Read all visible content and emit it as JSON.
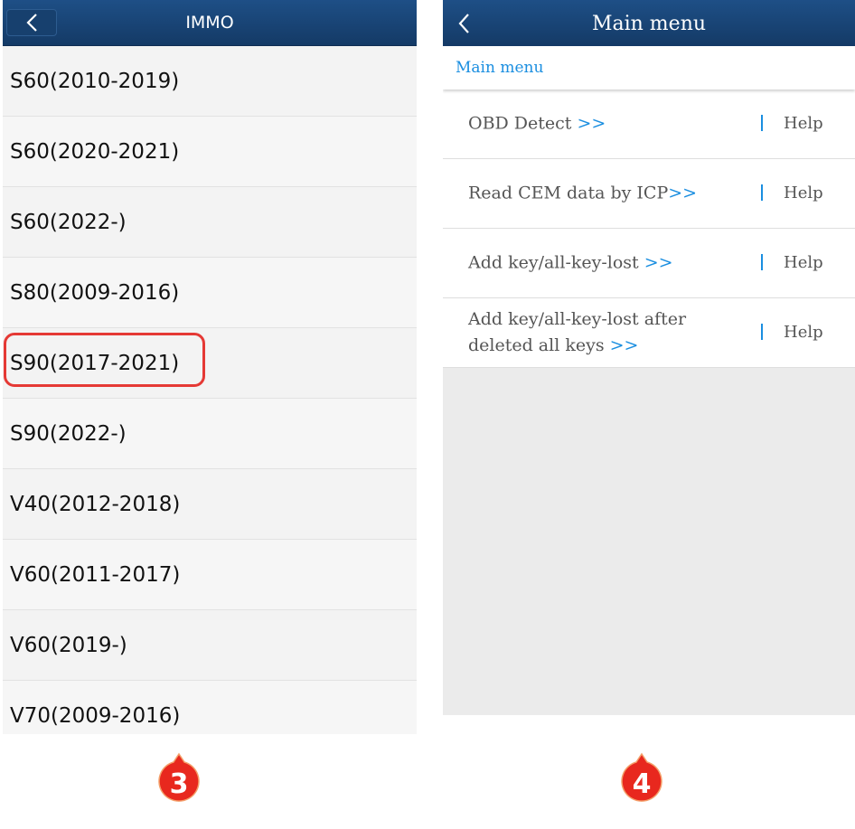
{
  "left_panel": {
    "header_title": "IMMO",
    "items": [
      {
        "label": "S60(2010-2019)"
      },
      {
        "label": "S60(2020-2021)"
      },
      {
        "label": "S60(2022-)"
      },
      {
        "label": "S80(2009-2016)"
      },
      {
        "label": "S90(2017-2021)"
      },
      {
        "label": "S90(2022-)"
      },
      {
        "label": "V40(2012-2018)"
      },
      {
        "label": "V60(2011-2017)"
      },
      {
        "label": "V60(2019-)"
      },
      {
        "label": "V70(2009-2016)"
      }
    ],
    "highlighted_item": "S90(2017-2021)",
    "highlight_color": "#e53935"
  },
  "right_panel": {
    "header_title": "Main menu",
    "breadcrumb": "Main menu",
    "items": [
      {
        "label": "OBD Detect ",
        "arrows": ">>",
        "help": "Help"
      },
      {
        "label": "Read CEM data by ICP",
        "arrows": ">>",
        "help": "Help"
      },
      {
        "label": "Add key/all-key-lost ",
        "arrows": ">>",
        "help": "Help"
      },
      {
        "label": "Add key/all-key-lost after deleted all keys ",
        "arrows": ">>",
        "help": "Help"
      }
    ]
  },
  "badges": {
    "left": "3",
    "right": "4",
    "color": "#e8281e"
  },
  "colors": {
    "header": "#1a4576",
    "link": "#1a8ee0"
  }
}
